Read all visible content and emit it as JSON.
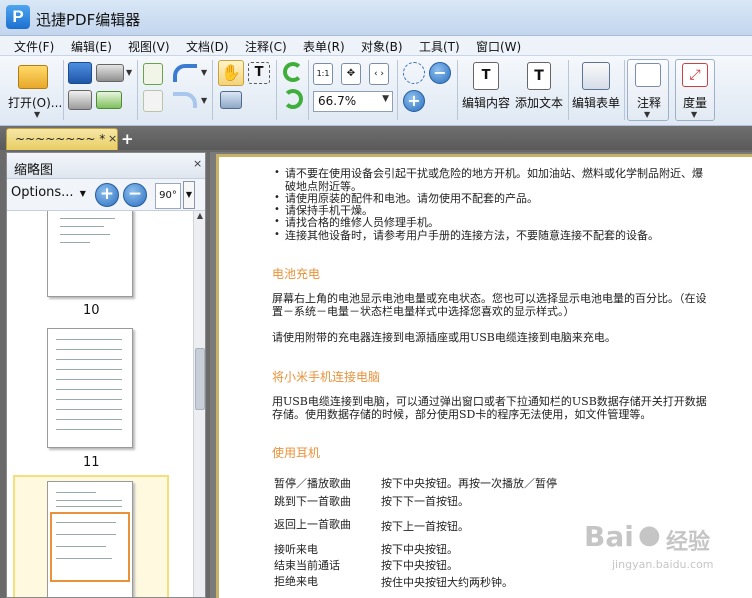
{
  "app": {
    "title": "迅捷PDF编辑器",
    "logo": "P"
  },
  "menu": [
    "文件(F)",
    "编辑(E)",
    "视图(V)",
    "文档(D)",
    "注释(C)",
    "表单(R)",
    "对象(B)",
    "工具(T)",
    "窗口(W)"
  ],
  "toolbar": {
    "open_label": "打开(O)...",
    "zoom_value": "66.7%",
    "edit_content": "编辑内容",
    "add_text": "添加文本",
    "edit_form": "编辑表单",
    "annotate": "注释",
    "measure": "度量"
  },
  "tab": {
    "label": "~~~~~~~~ *",
    "close": "×",
    "new": "+"
  },
  "panel": {
    "title": "缩略图",
    "close": "×",
    "options": "Options...",
    "rotate": "90°",
    "pages": [
      "10",
      "11"
    ]
  },
  "document": {
    "bullets": [
      "请不要在使用设备会引起干扰或危险的地方开机。如加油站、燃料或化学制品附近、爆",
      "破地点附近等。",
      "请使用原装的配件和电池。请勿使用不配套的产品。",
      "请保持手机干燥。",
      "请找合格的维修人员修理手机。",
      "连接其他设备时，请参考用户手册的连接方法，不要随意连接不配套的设备。"
    ],
    "battery_heading": "电池充电",
    "battery_p1": "屏幕右上角的电池显示电池电量或充电状态。您也可以选择显示电池电量的百分比。（在设",
    "battery_p2": "置－系统－电量－状态栏电量样式中选择您喜欢的显示样式。）",
    "battery_p3": "请使用附带的充电器连接到电源插座或用USB电缆连接到电脑来充电。",
    "connect_heading": "将小米手机连接电脑",
    "connect_p1": "用USB电缆连接到电脑，可以通过弹出窗口或者下拉通知栏的USB数据存储开关打开数据",
    "connect_p2": "存储。使用数据存储的时候，部分使用SD卡的程序无法使用，如文件管理等。",
    "headset_heading": "使用耳机",
    "headset_rows": [
      {
        "action": "暂停／播放歌曲",
        "desc": "按下中央按钮。再按一次播放／暂停"
      },
      {
        "action": "跳到下一首歌曲",
        "desc": "按下下一首按钮。"
      },
      {
        "action": "返回上一首歌曲",
        "desc": "按下上一首按钮。"
      },
      {
        "action": "接听来电",
        "desc": "按下中央按钮。"
      },
      {
        "action": "结束当前通话",
        "desc": "按下中央按钮。"
      },
      {
        "action": "拒绝来电",
        "desc": "按住中央按钮大约两秒钟。"
      }
    ]
  },
  "watermark": {
    "brand": "Bai",
    "brand2": "经验",
    "url": "jingyan.baidu.com"
  }
}
